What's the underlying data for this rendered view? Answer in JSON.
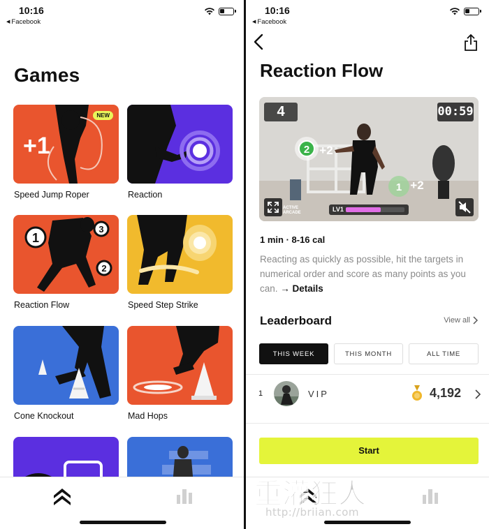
{
  "status_bar": {
    "time": "10:16",
    "back_app": "Facebook"
  },
  "games_screen": {
    "title": "Games",
    "cards": [
      {
        "label": "Speed Jump Roper",
        "badge": "NEW",
        "overlay_text": "+1",
        "bg_color": "#e9552e"
      },
      {
        "label": "Reaction",
        "bg_color": "#5b2fe0"
      },
      {
        "label": "Reaction Flow",
        "bg_color": "#e9552e",
        "targets": [
          "1",
          "3",
          "2"
        ]
      },
      {
        "label": "Speed Step Strike",
        "bg_color": "#f1ba2d"
      },
      {
        "label": "Cone Knockout",
        "bg_color": "#3a6fd8"
      },
      {
        "label": "Mad Hops",
        "bg_color": "#e9552e"
      },
      {
        "label": "",
        "bg_color": "#5b2fe0"
      },
      {
        "label": "",
        "bg_color": "#3a6fd8"
      }
    ]
  },
  "detail_screen": {
    "title": "Reaction Flow",
    "video": {
      "score": "4",
      "timer": "00:59",
      "level_label": "LV1",
      "level_progress": 0.6,
      "brand_text": [
        "ACTIVE",
        "ARCADE"
      ],
      "targets": [
        {
          "number": "2",
          "points": "+2"
        },
        {
          "number": "1",
          "points": "+2"
        }
      ]
    },
    "meta": "1 min · 8-16 cal",
    "description": "Reacting as quickly as possible, hit the targets in numerical order and score as many points as you can.",
    "details_link": "→ Details",
    "leaderboard": {
      "title": "Leaderboard",
      "view_all": "View all",
      "tabs": [
        "THIS WEEK",
        "THIS MONTH",
        "ALL TIME"
      ],
      "active_tab": "THIS WEEK",
      "entries": [
        {
          "rank": "1",
          "name": "VIP",
          "score": "4,192"
        }
      ]
    },
    "start_label": "Start"
  },
  "watermark": {
    "cjk_text": "重灌狂人",
    "url": "http://briian.com"
  },
  "icons": {
    "wifi": "wifi-icon",
    "battery": "battery-icon",
    "home_tab": "double-chevron-up-icon",
    "stats_tab": "bar-chart-icon",
    "back": "chevron-left-icon",
    "share": "share-icon",
    "expand": "expand-icon",
    "mute": "mute-icon",
    "medal": "gold-medal-icon"
  },
  "colors": {
    "accent_yellow": "#e4f43a",
    "level_fill": "#e06ee6",
    "new_badge": "#e9f55a"
  }
}
